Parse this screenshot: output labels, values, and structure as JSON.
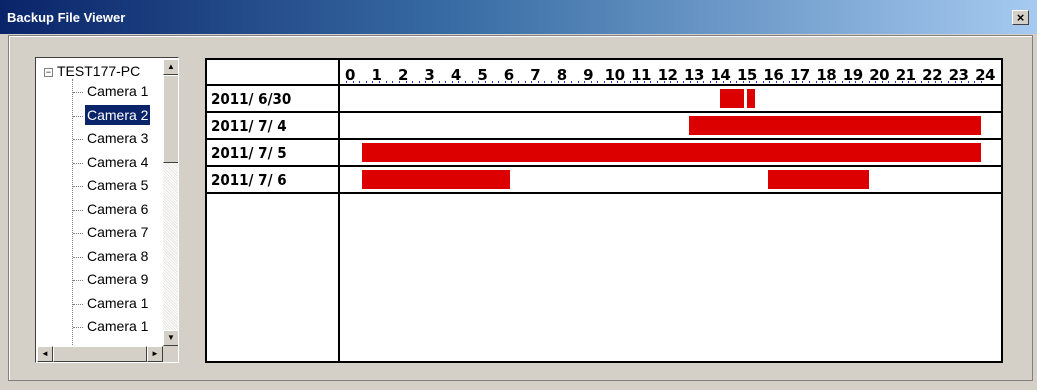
{
  "window": {
    "title": "Backup File Viewer",
    "close_glyph": "×"
  },
  "tree": {
    "root_label": "TEST177-PC",
    "expander_glyph": "−",
    "items": [
      {
        "label": "Camera 1"
      },
      {
        "label": "Camera 2",
        "selected": true
      },
      {
        "label": "Camera 3"
      },
      {
        "label": "Camera 4"
      },
      {
        "label": "Camera 5"
      },
      {
        "label": "Camera 6"
      },
      {
        "label": "Camera 7"
      },
      {
        "label": "Camera 8"
      },
      {
        "label": "Camera 9"
      },
      {
        "label": "Camera 1"
      },
      {
        "label": "Camera 1"
      }
    ],
    "scroll_up_glyph": "▲",
    "scroll_down_glyph": "▼",
    "scroll_left_glyph": "◄",
    "scroll_right_glyph": "►"
  },
  "timeline": {
    "hours": [
      "0",
      "1",
      "2",
      "3",
      "4",
      "5",
      "6",
      "7",
      "8",
      "9",
      "10",
      "11",
      "12",
      "13",
      "14",
      "15",
      "16",
      "17",
      "18",
      "19",
      "20",
      "21",
      "22",
      "23",
      "24"
    ],
    "rows": [
      {
        "date": "2011/ 6/30",
        "segments": [
          [
            14.0,
            14.9
          ],
          [
            15.0,
            15.3
          ]
        ]
      },
      {
        "date": "2011/ 7/ 4",
        "segments": [
          [
            12.8,
            23.85
          ]
        ]
      },
      {
        "date": "2011/ 7/ 5",
        "segments": [
          [
            0.45,
            23.85
          ]
        ]
      },
      {
        "date": "2011/ 7/ 6",
        "segments": [
          [
            0.45,
            6.05
          ],
          [
            15.8,
            19.6
          ]
        ]
      }
    ],
    "bar_color": "#dd0000",
    "tick_color": "#1e3cc8"
  }
}
